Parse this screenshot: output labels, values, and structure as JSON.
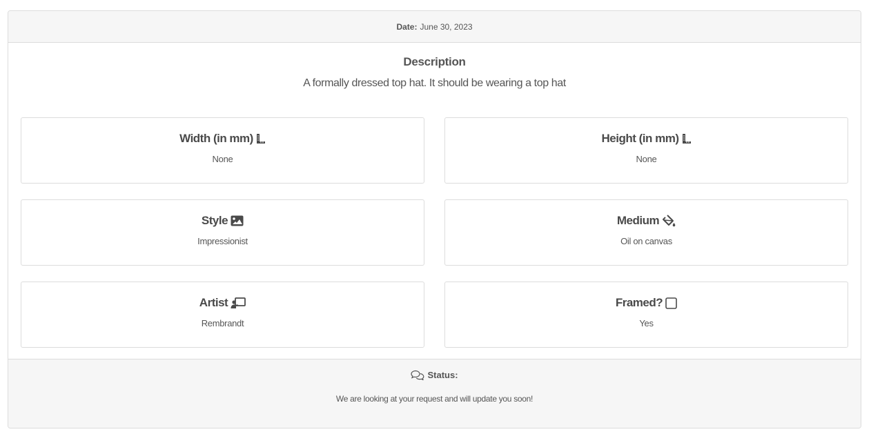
{
  "header": {
    "date_label": "Date:",
    "date_value": "June 30, 2023"
  },
  "description": {
    "title": "Description",
    "text": "A formally dressed top hat. It should be wearing a top hat"
  },
  "fields": [
    {
      "label": "Width (in mm)",
      "value": "None",
      "icon": "ruler-icon"
    },
    {
      "label": "Height (in mm)",
      "value": "None",
      "icon": "ruler-icon"
    },
    {
      "label": "Style",
      "value": "Impressionist",
      "icon": "image-icon"
    },
    {
      "label": "Medium",
      "value": "Oil on canvas",
      "icon": "paint-bucket-icon"
    },
    {
      "label": "Artist",
      "value": "Rembrandt",
      "icon": "chalkboard-teacher-icon"
    },
    {
      "label": "Framed?",
      "value": "Yes",
      "icon": "square-outline-icon"
    }
  ],
  "footer": {
    "status_label": "Status:",
    "status_icon": "comments-icon",
    "message": "We are looking at your request and will update you soon!"
  }
}
